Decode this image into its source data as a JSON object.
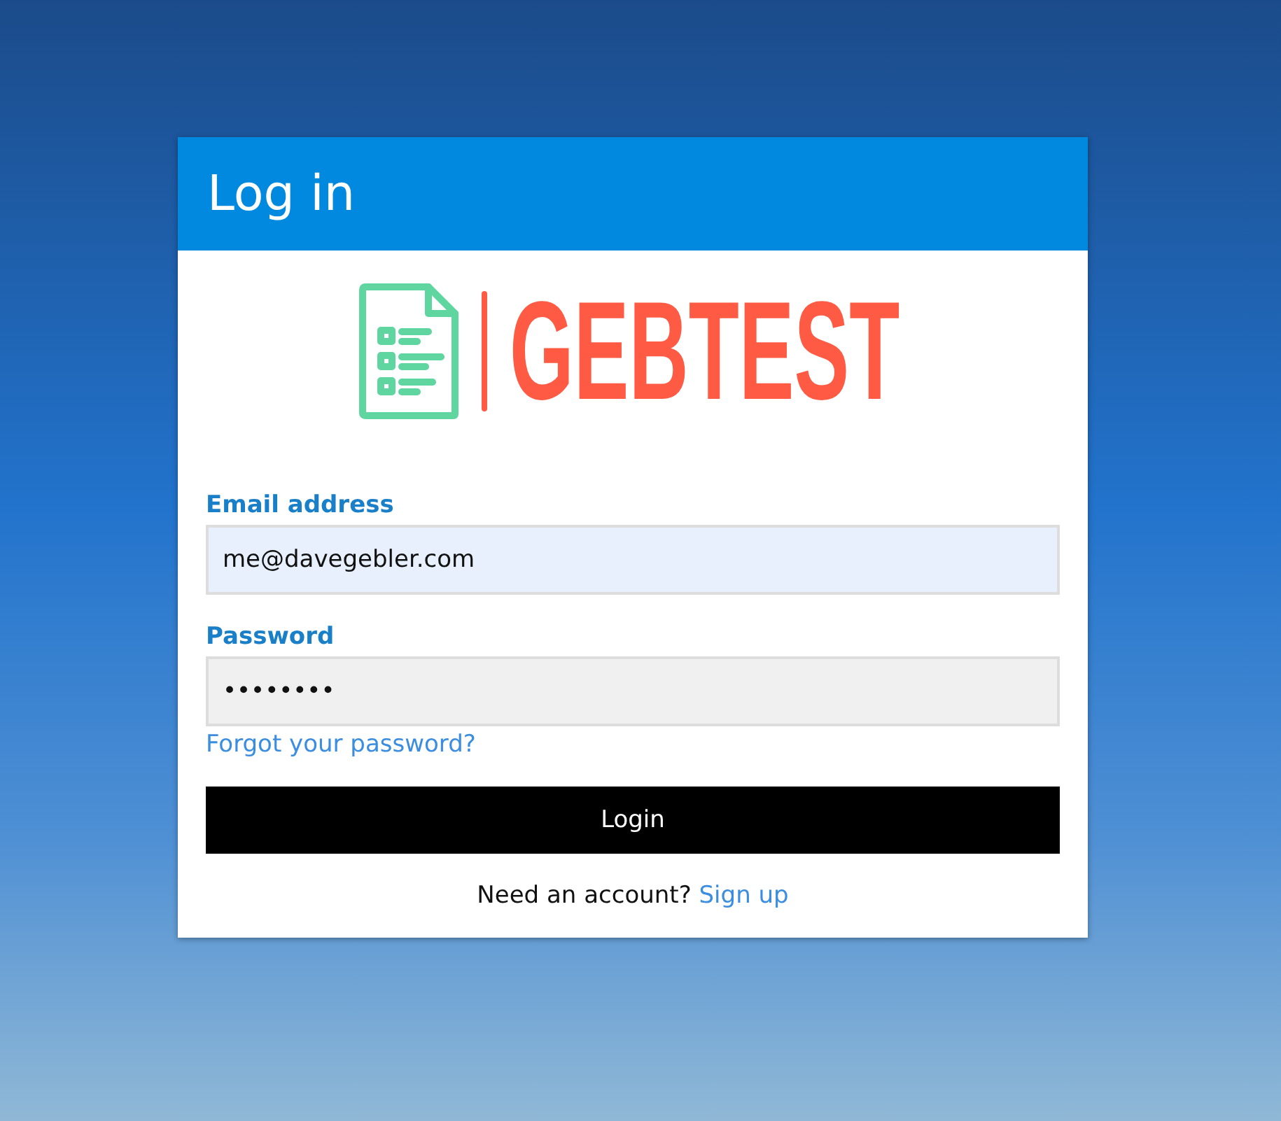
{
  "dialog": {
    "title": "Log in"
  },
  "logo": {
    "text": "GEBTEST"
  },
  "fields": [
    {
      "label": "Email address",
      "value": "me@davegebler.com",
      "filled": true
    },
    {
      "label": "Password",
      "value": "••••••••",
      "filled": false
    }
  ],
  "forgot_link": "Forgot your password?",
  "submit_button": "Login",
  "footer": {
    "text": "Need an account?",
    "link": "Sign up"
  }
}
